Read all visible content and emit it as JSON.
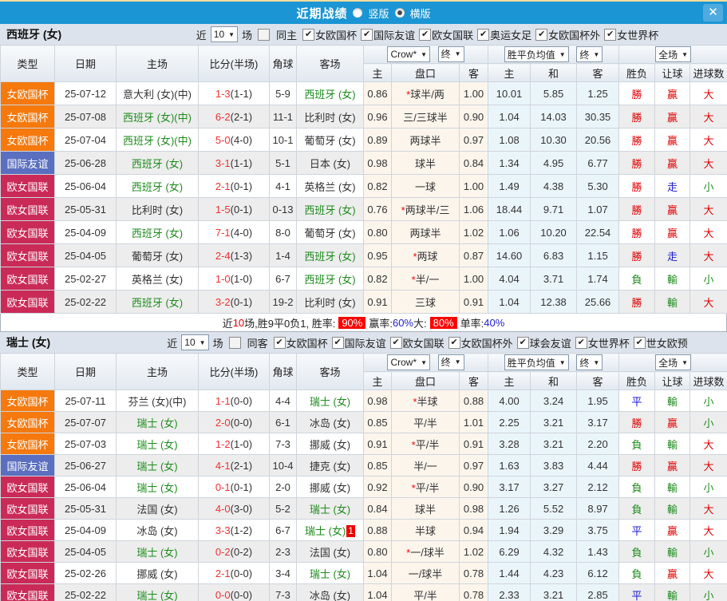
{
  "titlebar": {
    "title": "近期战绩",
    "radio_vertical_label": "竖版",
    "radio_horizontal_label": "横版",
    "vertical_selected": false,
    "horizontal_selected": true
  },
  "columns": {
    "main": [
      "类型",
      "日期",
      "主场",
      "比分(半场)",
      "角球",
      "客场"
    ],
    "selects": {
      "crow": "Crow*",
      "final_a": "终",
      "wdl_avg": "胜平负均值",
      "final_b": "终",
      "full": "全场"
    },
    "sub": [
      "主",
      "盘口",
      "客",
      "主",
      "和",
      "客",
      "胜负",
      "让球",
      "进球数"
    ]
  },
  "sections": [
    {
      "team": "西班牙 (女)",
      "filter": {
        "near_label": "近",
        "games_value": "10",
        "games_label": "场",
        "same_label": "同主",
        "same_checked": false,
        "comps": [
          "女欧国杯",
          "国际友谊",
          "欧女国联",
          "奥运女足",
          "女欧国杯外",
          "女世界杯"
        ]
      },
      "rows": [
        {
          "type": "女欧国杯",
          "type_key": "cup",
          "date": "25-07-12",
          "home": "意大利 (女)(中)",
          "home_focus": false,
          "score": "1-3",
          "half": "(1-1)",
          "corner": "5-9",
          "away": "西班牙 (女)",
          "away_focus": true,
          "away_badge": "",
          "odds_home": "0.86",
          "handicap_star": true,
          "handicap": "球半/两",
          "odds_away": "1.00",
          "avg_home": "10.01",
          "avg_draw": "5.85",
          "avg_away": "1.25",
          "results": [
            "勝",
            "贏",
            "大"
          ]
        },
        {
          "type": "女欧国杯",
          "type_key": "cup",
          "date": "25-07-08",
          "home": "西班牙 (女)(中)",
          "home_focus": true,
          "score": "6-2",
          "half": "(2-1)",
          "corner": "11-1",
          "away": "比利时 (女)",
          "away_focus": false,
          "away_badge": "",
          "odds_home": "0.96",
          "handicap_star": false,
          "handicap": "三/三球半",
          "odds_away": "0.90",
          "avg_home": "1.04",
          "avg_draw": "14.03",
          "avg_away": "30.35",
          "results": [
            "勝",
            "贏",
            "大"
          ]
        },
        {
          "type": "女欧国杯",
          "type_key": "cup",
          "date": "25-07-04",
          "home": "西班牙 (女)(中)",
          "home_focus": true,
          "score": "5-0",
          "half": "(4-0)",
          "corner": "10-1",
          "away": "葡萄牙 (女)",
          "away_focus": false,
          "away_badge": "",
          "odds_home": "0.89",
          "handicap_star": false,
          "handicap": "两球半",
          "odds_away": "0.97",
          "avg_home": "1.08",
          "avg_draw": "10.30",
          "avg_away": "20.56",
          "results": [
            "勝",
            "贏",
            "大"
          ]
        },
        {
          "type": "国际友谊",
          "type_key": "friendly",
          "date": "25-06-28",
          "home": "西班牙 (女)",
          "home_focus": true,
          "score": "3-1",
          "half": "(1-1)",
          "corner": "5-1",
          "away": "日本 (女)",
          "away_focus": false,
          "away_badge": "",
          "odds_home": "0.98",
          "handicap_star": false,
          "handicap": "球半",
          "odds_away": "0.84",
          "avg_home": "1.34",
          "avg_draw": "4.95",
          "avg_away": "6.77",
          "results": [
            "勝",
            "贏",
            "大"
          ]
        },
        {
          "type": "欧女国联",
          "type_key": "league",
          "date": "25-06-04",
          "home": "西班牙 (女)",
          "home_focus": true,
          "score": "2-1",
          "half": "(0-1)",
          "corner": "4-1",
          "away": "英格兰 (女)",
          "away_focus": false,
          "away_badge": "",
          "odds_home": "0.82",
          "handicap_star": false,
          "handicap": "一球",
          "odds_away": "1.00",
          "avg_home": "1.49",
          "avg_draw": "4.38",
          "avg_away": "5.30",
          "results": [
            "勝",
            "走",
            "小"
          ]
        },
        {
          "type": "欧女国联",
          "type_key": "league",
          "date": "25-05-31",
          "home": "比利时 (女)",
          "home_focus": false,
          "score": "1-5",
          "half": "(0-1)",
          "corner": "0-13",
          "away": "西班牙 (女)",
          "away_focus": true,
          "away_badge": "",
          "odds_home": "0.76",
          "handicap_star": true,
          "handicap": "两球半/三",
          "odds_away": "1.06",
          "avg_home": "18.44",
          "avg_draw": "9.71",
          "avg_away": "1.07",
          "results": [
            "勝",
            "贏",
            "大"
          ]
        },
        {
          "type": "欧女国联",
          "type_key": "league",
          "date": "25-04-09",
          "home": "西班牙 (女)",
          "home_focus": true,
          "score": "7-1",
          "half": "(4-0)",
          "corner": "8-0",
          "away": "葡萄牙 (女)",
          "away_focus": false,
          "away_badge": "",
          "odds_home": "0.80",
          "handicap_star": false,
          "handicap": "两球半",
          "odds_away": "1.02",
          "avg_home": "1.06",
          "avg_draw": "10.20",
          "avg_away": "22.54",
          "results": [
            "勝",
            "贏",
            "大"
          ]
        },
        {
          "type": "欧女国联",
          "type_key": "league",
          "date": "25-04-05",
          "home": "葡萄牙 (女)",
          "home_focus": false,
          "score": "2-4",
          "half": "(1-3)",
          "corner": "1-4",
          "away": "西班牙 (女)",
          "away_focus": true,
          "away_badge": "",
          "odds_home": "0.95",
          "handicap_star": true,
          "handicap": "两球",
          "odds_away": "0.87",
          "avg_home": "14.60",
          "avg_draw": "6.83",
          "avg_away": "1.15",
          "results": [
            "勝",
            "走",
            "大"
          ]
        },
        {
          "type": "欧女国联",
          "type_key": "league",
          "date": "25-02-27",
          "home": "英格兰 (女)",
          "home_focus": false,
          "score": "1-0",
          "half": "(1-0)",
          "corner": "6-7",
          "away": "西班牙 (女)",
          "away_focus": true,
          "away_badge": "",
          "odds_home": "0.82",
          "handicap_star": true,
          "handicap": "半/一",
          "odds_away": "1.00",
          "avg_home": "4.04",
          "avg_draw": "3.71",
          "avg_away": "1.74",
          "results": [
            "負",
            "輸",
            "小"
          ]
        },
        {
          "type": "欧女国联",
          "type_key": "league",
          "date": "25-02-22",
          "home": "西班牙 (女)",
          "home_focus": true,
          "score": "3-2",
          "half": "(0-1)",
          "corner": "19-2",
          "away": "比利时 (女)",
          "away_focus": false,
          "away_badge": "",
          "odds_home": "0.91",
          "handicap_star": false,
          "handicap": "三球",
          "odds_away": "0.91",
          "avg_home": "1.04",
          "avg_draw": "12.38",
          "avg_away": "25.66",
          "results": [
            "勝",
            "輸",
            "大"
          ]
        }
      ],
      "summary": {
        "segments": [
          {
            "text": "近",
            "style": "plain"
          },
          {
            "text": "10",
            "style": "red"
          },
          {
            "text": "场,胜9平0负1, 胜率:",
            "style": "plain"
          },
          {
            "text": "90%",
            "style": "redbox"
          },
          {
            "text": "赢率:",
            "style": "plain"
          },
          {
            "text": "60%",
            "style": "blue"
          },
          {
            "text": " 大:",
            "style": "plain"
          },
          {
            "text": "80%",
            "style": "redbox"
          },
          {
            "text": "单率:",
            "style": "plain"
          },
          {
            "text": "40%",
            "style": "blue"
          }
        ]
      }
    },
    {
      "team": "瑞士 (女)",
      "filter": {
        "near_label": "近",
        "games_value": "10",
        "games_label": "场",
        "same_label": "同客",
        "same_checked": false,
        "comps": [
          "女欧国杯",
          "国际友谊",
          "欧女国联",
          "女欧国杯外",
          "球会友谊",
          "女世界杯",
          "世女欧预"
        ]
      },
      "rows": [
        {
          "type": "女欧国杯",
          "type_key": "cup",
          "date": "25-07-11",
          "home": "芬兰 (女)(中)",
          "home_focus": false,
          "score": "1-1",
          "half": "(0-0)",
          "corner": "4-4",
          "away": "瑞士 (女)",
          "away_focus": true,
          "away_badge": "",
          "odds_home": "0.98",
          "handicap_star": true,
          "handicap": "半球",
          "odds_away": "0.88",
          "avg_home": "4.00",
          "avg_draw": "3.24",
          "avg_away": "1.95",
          "results": [
            "平",
            "輸",
            "小"
          ]
        },
        {
          "type": "女欧国杯",
          "type_key": "cup",
          "date": "25-07-07",
          "home": "瑞士 (女)",
          "home_focus": true,
          "score": "2-0",
          "half": "(0-0)",
          "corner": "6-1",
          "away": "冰岛 (女)",
          "away_focus": false,
          "away_badge": "",
          "odds_home": "0.85",
          "handicap_star": false,
          "handicap": "平/半",
          "odds_away": "1.01",
          "avg_home": "2.25",
          "avg_draw": "3.21",
          "avg_away": "3.17",
          "results": [
            "勝",
            "贏",
            "小"
          ]
        },
        {
          "type": "女欧国杯",
          "type_key": "cup",
          "date": "25-07-03",
          "home": "瑞士 (女)",
          "home_focus": true,
          "score": "1-2",
          "half": "(1-0)",
          "corner": "7-3",
          "away": "挪威 (女)",
          "away_focus": false,
          "away_badge": "",
          "odds_home": "0.91",
          "handicap_star": true,
          "handicap": "平/半",
          "odds_away": "0.91",
          "avg_home": "3.28",
          "avg_draw": "3.21",
          "avg_away": "2.20",
          "results": [
            "負",
            "輸",
            "大"
          ]
        },
        {
          "type": "国际友谊",
          "type_key": "friendly",
          "date": "25-06-27",
          "home": "瑞士 (女)",
          "home_focus": true,
          "score": "4-1",
          "half": "(2-1)",
          "corner": "10-4",
          "away": "捷克 (女)",
          "away_focus": false,
          "away_badge": "",
          "odds_home": "0.85",
          "handicap_star": false,
          "handicap": "半/一",
          "odds_away": "0.97",
          "avg_home": "1.63",
          "avg_draw": "3.83",
          "avg_away": "4.44",
          "results": [
            "勝",
            "贏",
            "大"
          ]
        },
        {
          "type": "欧女国联",
          "type_key": "league",
          "date": "25-06-04",
          "home": "瑞士 (女)",
          "home_focus": true,
          "score": "0-1",
          "half": "(0-1)",
          "corner": "2-0",
          "away": "挪威 (女)",
          "away_focus": false,
          "away_badge": "",
          "odds_home": "0.92",
          "handicap_star": true,
          "handicap": "平/半",
          "odds_away": "0.90",
          "avg_home": "3.17",
          "avg_draw": "3.27",
          "avg_away": "2.12",
          "results": [
            "負",
            "輸",
            "小"
          ]
        },
        {
          "type": "欧女国联",
          "type_key": "league",
          "date": "25-05-31",
          "home": "法国 (女)",
          "home_focus": false,
          "score": "4-0",
          "half": "(3-0)",
          "corner": "5-2",
          "away": "瑞士 (女)",
          "away_focus": true,
          "away_badge": "",
          "odds_home": "0.84",
          "handicap_star": false,
          "handicap": "球半",
          "odds_away": "0.98",
          "avg_home": "1.26",
          "avg_draw": "5.52",
          "avg_away": "8.97",
          "results": [
            "負",
            "輸",
            "大"
          ]
        },
        {
          "type": "欧女国联",
          "type_key": "league",
          "date": "25-04-09",
          "home": "冰岛 (女)",
          "home_focus": false,
          "score": "3-3",
          "half": "(1-2)",
          "corner": "6-7",
          "away": "瑞士 (女)",
          "away_focus": true,
          "away_badge": "1",
          "odds_home": "0.88",
          "handicap_star": false,
          "handicap": "半球",
          "odds_away": "0.94",
          "avg_home": "1.94",
          "avg_draw": "3.29",
          "avg_away": "3.75",
          "results": [
            "平",
            "贏",
            "大"
          ]
        },
        {
          "type": "欧女国联",
          "type_key": "league",
          "date": "25-04-05",
          "home": "瑞士 (女)",
          "home_focus": true,
          "score": "0-2",
          "half": "(0-2)",
          "corner": "2-3",
          "away": "法国 (女)",
          "away_focus": false,
          "away_badge": "",
          "odds_home": "0.80",
          "handicap_star": true,
          "handicap": "一/球半",
          "odds_away": "1.02",
          "avg_home": "6.29",
          "avg_draw": "4.32",
          "avg_away": "1.43",
          "results": [
            "負",
            "輸",
            "小"
          ]
        },
        {
          "type": "欧女国联",
          "type_key": "league",
          "date": "25-02-26",
          "home": "挪威 (女)",
          "home_focus": false,
          "score": "2-1",
          "half": "(0-0)",
          "corner": "3-4",
          "away": "瑞士 (女)",
          "away_focus": true,
          "away_badge": "",
          "odds_home": "1.04",
          "handicap_star": false,
          "handicap": "一/球半",
          "odds_away": "0.78",
          "avg_home": "1.44",
          "avg_draw": "4.23",
          "avg_away": "6.12",
          "results": [
            "負",
            "贏",
            "大"
          ]
        },
        {
          "type": "欧女国联",
          "type_key": "league",
          "date": "25-02-22",
          "home": "瑞士 (女)",
          "home_focus": true,
          "score": "0-0",
          "half": "(0-0)",
          "corner": "7-3",
          "away": "冰岛 (女)",
          "away_focus": false,
          "away_badge": "",
          "odds_home": "1.04",
          "handicap_star": false,
          "handicap": "平/半",
          "odds_away": "0.78",
          "avg_home": "2.33",
          "avg_draw": "3.21",
          "avg_away": "2.85",
          "results": [
            "平",
            "輸",
            "小"
          ]
        }
      ]
    }
  ]
}
